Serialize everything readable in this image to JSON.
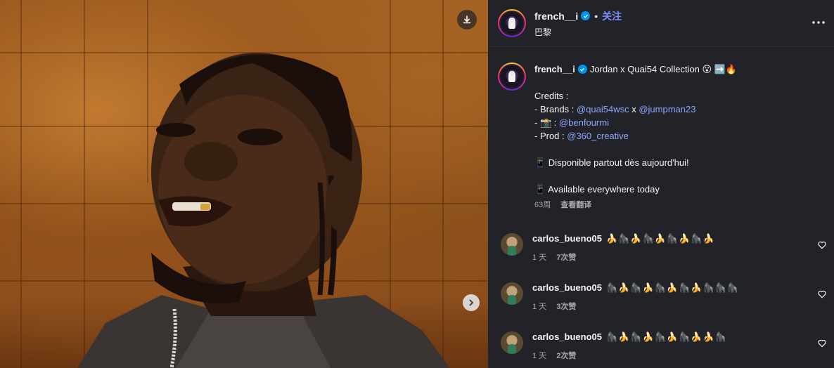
{
  "post": {
    "username": "french__i",
    "location": "巴黎",
    "follow_label": "关注",
    "dot": "•"
  },
  "caption": {
    "username": "french__i",
    "title": "Jordan x Quai54 Collection 😮 ➡️🔥",
    "credits_label": "Credits :",
    "brands_prefix": "- Brands : ",
    "brand1": "@quai54wsc",
    "brands_sep": " x ",
    "brand2": "@jumpman23",
    "photo_prefix": "- 📸 : ",
    "photo": "@benfourmi",
    "prod_prefix": "- Prod : ",
    "prod": "@360_creative",
    "available_fr": "📱 Disponible partout dès aujourd'hui!",
    "available_en": "📱 Available everywhere today",
    "age": "63周",
    "translate": "查看翻译"
  },
  "comments": [
    {
      "username": "carlos_bueno05",
      "text": "🍌🦍🍌🦍🍌🦍🍌🦍🍌",
      "age": "1 天",
      "likes": "7次赞"
    },
    {
      "username": "carlos_bueno05",
      "text": "🦍🍌🦍🍌🦍🍌🦍🍌🦍🦍🦍",
      "age": "1 天",
      "likes": "3次赞"
    },
    {
      "username": "carlos_bueno05",
      "text": "🦍🍌🦍🍌🦍🍌🦍🍌🍌🦍",
      "age": "1 天",
      "likes": "2次赞"
    }
  ],
  "icons": {
    "download": "download-icon",
    "next": "chevron-right-icon",
    "more": "more-horizontal-icon",
    "verified": "verified-badge-icon",
    "heart": "heart-outline-icon"
  },
  "colors": {
    "panel_bg": "#212328",
    "mention": "#8ea6ff",
    "follow": "#7b8cff",
    "verified": "#0095f6"
  }
}
